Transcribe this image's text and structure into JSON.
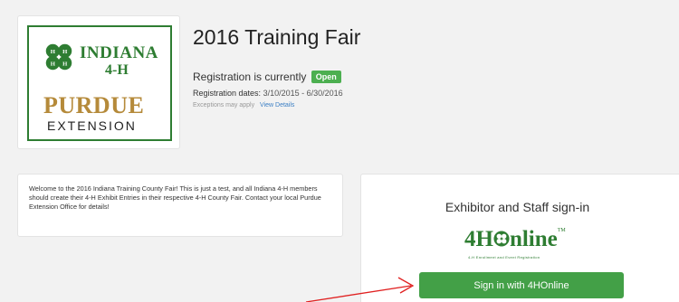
{
  "logo": {
    "indiana": "INDIANA",
    "four_h": "4-H",
    "purdue": "PURDUE",
    "extension": "EXTENSION"
  },
  "header": {
    "title": "2016 Training Fair"
  },
  "registration": {
    "status_text": "Registration is currently",
    "status_badge": "Open",
    "dates_label": "Registration dates:",
    "dates_value": "3/10/2015 - 6/30/2016",
    "exceptions_text": "Exceptions may apply",
    "view_details": "View Details"
  },
  "welcome": {
    "text": "Welcome to the 2016 Indiana Training County Fair! This is just a test, and all Indiana 4-H members should create their 4-H Exhibit Entries in their respective 4-H County Fair. Contact your local Purdue Extension Office for details!"
  },
  "signin": {
    "heading": "Exhibitor and Staff sign-in",
    "logo_4h": "4H",
    "logo_online": "nline",
    "logo_tm": "TM",
    "logo_subtitle": "4-H Enrollment and Event Registration",
    "button_label": "Sign in with 4HOnline"
  },
  "colors": {
    "brand_green": "#2e7d32",
    "button_green": "#43a047",
    "badge_green": "#4caf50",
    "purdue_gold": "#b58a3a",
    "link_blue": "#3b7fc4",
    "annotation_red": "#e02020"
  }
}
